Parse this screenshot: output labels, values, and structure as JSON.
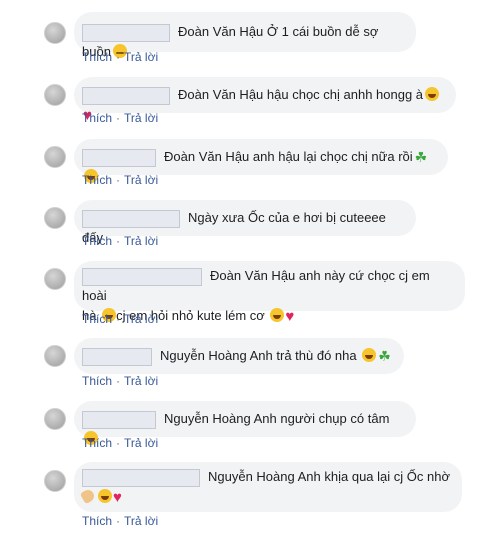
{
  "actions": {
    "like": "Thích",
    "reply": "Trả lời",
    "separator": "·"
  },
  "comments": [
    {
      "mention": "Đoàn Văn Hậu",
      "text": "Ở 1 cái buồn dễ sợ buồn",
      "emojis": [
        "sad-relieved-emoji"
      ]
    },
    {
      "mention": "Đoàn Văn Hậu",
      "text": "hậu chọc chị anhh hongg à",
      "emojis": [
        "laughing-emoji",
        "heart-icon"
      ]
    },
    {
      "mention": "Đoàn Văn Hậu",
      "text": "anh hậu lại chọc chị nữa rồi",
      "emojis": [
        "four-leaf-clover-icon",
        "laughing-emoji"
      ]
    },
    {
      "mention": "",
      "text": "Ngày xưa Ốc của e hơi bị cuteeee đấy",
      "emojis": []
    },
    {
      "mention": "Đoàn Văn Hậu",
      "text": "anh này cứ chọc cj em hoài",
      "text2": "hà",
      "text3": "cj em hỏi nhỏ kute lém cơ",
      "emojis": [
        "grinning-emoji",
        "grinning-emoji",
        "heart-icon"
      ]
    },
    {
      "mention": "Nguyễn Hoàng Anh",
      "text": "trả thù đó nha",
      "emojis": [
        "grinning-emoji",
        "four-leaf-clover-icon"
      ]
    },
    {
      "mention": "Nguyễn Hoàng Anh",
      "text": "người chụp có tâm",
      "emojis": [
        "laughing-emoji"
      ]
    },
    {
      "mention": "Nguyễn Hoàng Anh",
      "text": "khịa qua lại cj Ốc nhờ",
      "emojis": [
        "waving-hand-emoji",
        "grinning-emoji",
        "heart-icon"
      ]
    }
  ]
}
